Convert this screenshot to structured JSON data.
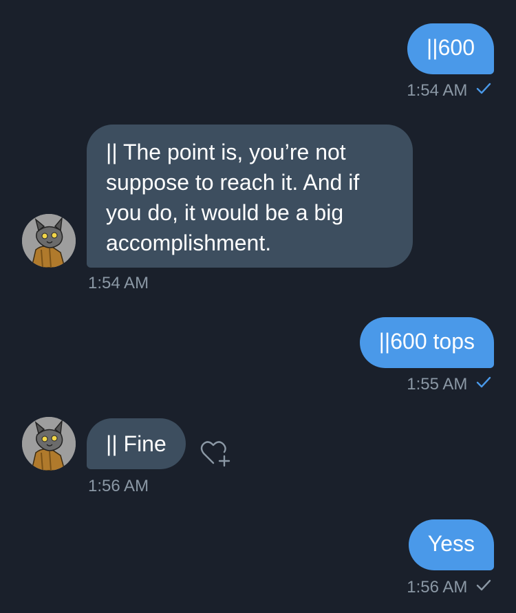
{
  "messages": [
    {
      "direction": "outgoing",
      "text": "||600",
      "time": "1:54 AM",
      "status": "read"
    },
    {
      "direction": "incoming",
      "text_lines": [
        "|| The point is, you’re not",
        "suppose to reach it. And if",
        "you do, it would be a big",
        "accomplishment."
      ],
      "time": "1:54 AM"
    },
    {
      "direction": "outgoing",
      "text": "||600 tops",
      "time": "1:55 AM",
      "status": "read"
    },
    {
      "direction": "incoming",
      "text": "|| Fine",
      "time": "1:56 AM"
    },
    {
      "direction": "outgoing",
      "text": "Yess",
      "time": "1:56 AM",
      "status": "sent"
    }
  ],
  "icons": {
    "read_receipt": "check-icon",
    "sent_receipt": "check-icon",
    "react": "heart-plus-icon",
    "avatar": "wolf-avatar"
  },
  "colors": {
    "background": "#1a202b",
    "outgoing_bubble": "#4a99e9",
    "incoming_bubble": "#3d4e5f",
    "timestamp": "#8b98a5",
    "read_check": "#4a99e9",
    "sent_check": "#8b98a5"
  }
}
